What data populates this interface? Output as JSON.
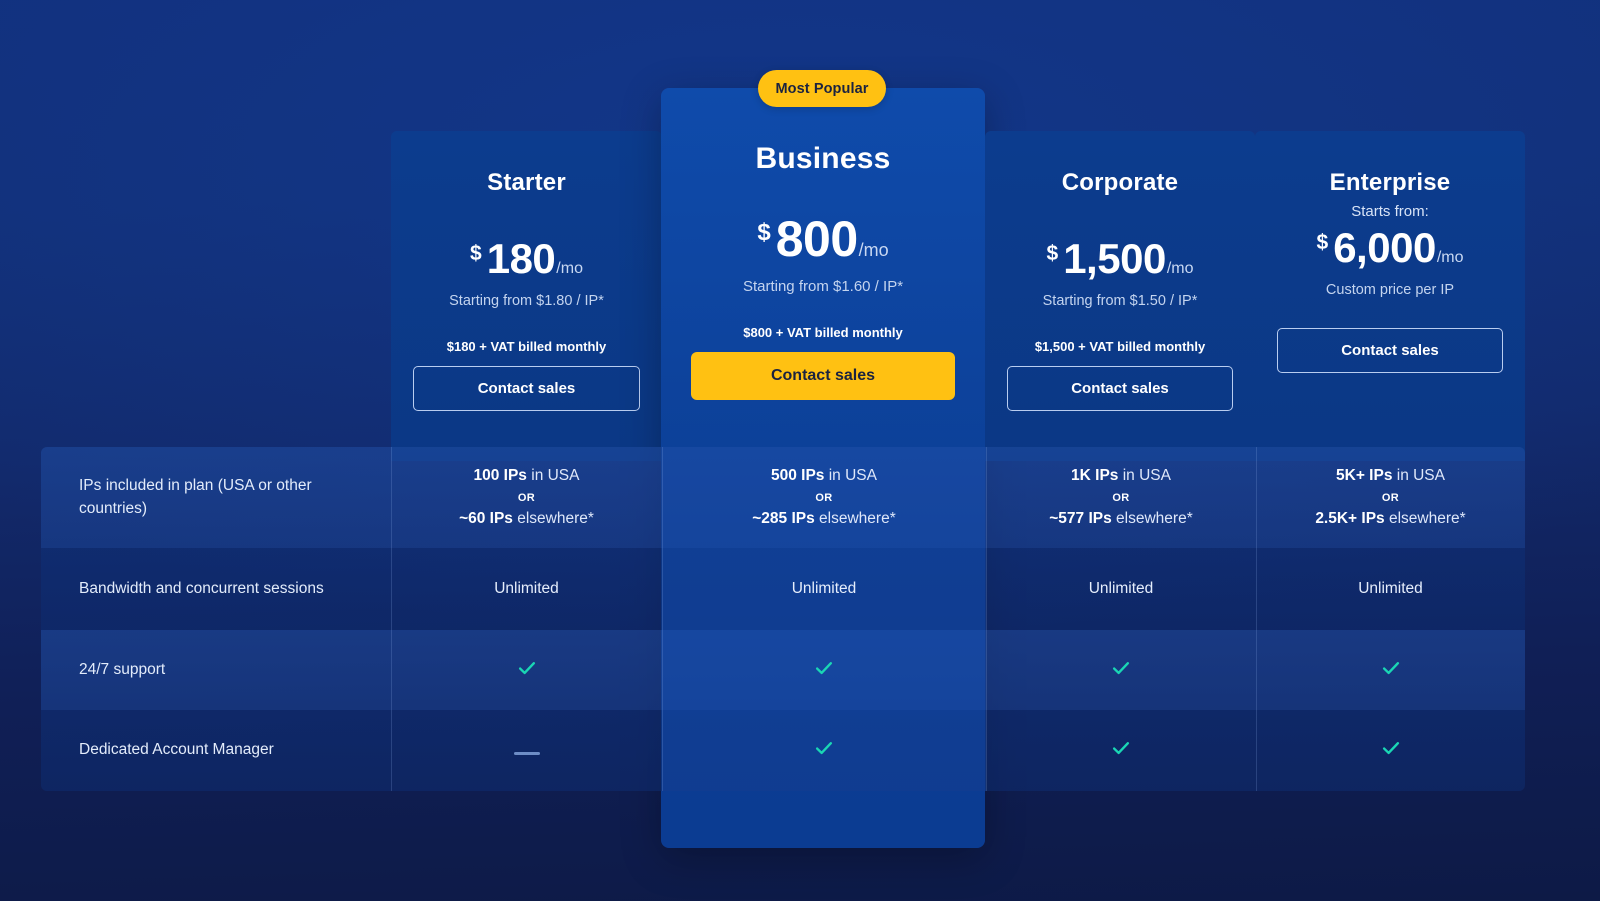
{
  "theme": {
    "page_background_top": "#11307c",
    "page_background_bottom": "#0d1a46",
    "card_background": "#0c3c8e",
    "featured_card_background": "#0f4bab",
    "accent_yellow": "#ffc112",
    "accent_yellow_text": "#1b2340",
    "check_color": "#1ad6b4",
    "dash_color": "#6d8dc6"
  },
  "badge": {
    "label": "Most Popular"
  },
  "plans": [
    {
      "id": "starter",
      "name": "Starter",
      "starts_from_label": "",
      "currency": "$",
      "amount": "180",
      "per": "/mo",
      "sub_note": "Starting from $1.80 / IP*",
      "vat_note": "$180 + VAT billed monthly",
      "cta_label": "Contact sales",
      "featured": false
    },
    {
      "id": "business",
      "name": "Business",
      "starts_from_label": "",
      "currency": "$",
      "amount": "800",
      "per": "/mo",
      "sub_note": "Starting from $1.60 / IP*",
      "vat_note": "$800 + VAT billed monthly",
      "cta_label": "Contact sales",
      "featured": true
    },
    {
      "id": "corporate",
      "name": "Corporate",
      "starts_from_label": "",
      "currency": "$",
      "amount": "1,500",
      "per": "/mo",
      "sub_note": "Starting from $1.50 / IP*",
      "vat_note": "$1,500 + VAT billed monthly",
      "cta_label": "Contact sales",
      "featured": false
    },
    {
      "id": "enterprise",
      "name": "Enterprise",
      "starts_from_label": "Starts from:",
      "currency": "$",
      "amount": "6,000",
      "per": "/mo",
      "sub_note": "Custom price per IP",
      "vat_note": "",
      "cta_label": "Contact sales",
      "featured": false
    }
  ],
  "features": [
    {
      "id": "ips-included",
      "label": "IPs included in plan (USA or other countries)",
      "type": "ip",
      "or_label": "OR",
      "values": [
        {
          "usa_count": "100 IPs",
          "usa_suffix": " in USA",
          "other_count": "~60 IPs",
          "other_suffix": " elsewhere*"
        },
        {
          "usa_count": "500 IPs",
          "usa_suffix": " in USA",
          "other_count": "~285 IPs",
          "other_suffix": " elsewhere*"
        },
        {
          "usa_count": "1K IPs",
          "usa_suffix": " in USA",
          "other_count": "~577 IPs",
          "other_suffix": " elsewhere*"
        },
        {
          "usa_count": "5K+ IPs",
          "usa_suffix": " in USA",
          "other_count": "2.5K+ IPs",
          "other_suffix": " elsewhere*"
        }
      ]
    },
    {
      "id": "bandwidth-sessions",
      "label": "Bandwidth and concurrent sessions",
      "type": "text",
      "values": [
        "Unlimited",
        "Unlimited",
        "Unlimited",
        "Unlimited"
      ]
    },
    {
      "id": "support",
      "label": "24/7 support",
      "type": "icon",
      "values": [
        "check",
        "check",
        "check",
        "check"
      ]
    },
    {
      "id": "dedicated-account-manager",
      "label": "Dedicated Account Manager",
      "type": "icon",
      "values": [
        "dash",
        "check",
        "check",
        "check"
      ]
    }
  ]
}
